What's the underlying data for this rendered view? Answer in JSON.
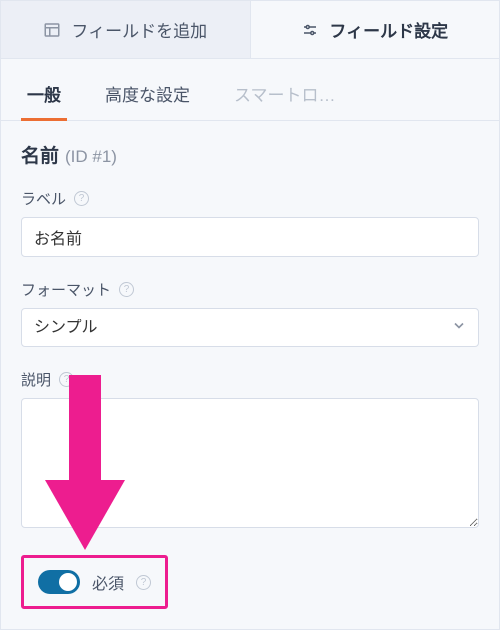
{
  "topTabs": {
    "addField": "フィールドを追加",
    "fieldSettings": "フィールド設定"
  },
  "subTabs": {
    "general": "一般",
    "advanced": "高度な設定",
    "smart": "スマートロ…"
  },
  "field": {
    "title": "名前",
    "id": "(ID #1)"
  },
  "labels": {
    "label": "ラベル",
    "format": "フォーマット",
    "description": "説明",
    "required": "必須"
  },
  "values": {
    "labelValue": "お名前",
    "formatValue": "シンプル",
    "descriptionValue": ""
  }
}
